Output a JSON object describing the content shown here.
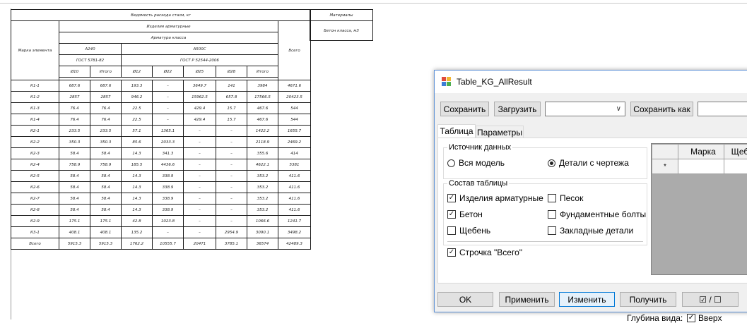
{
  "cad": {
    "header": {
      "title": "Ведомость расхода стали, кг",
      "materials": "Материалы",
      "products": "Изделия арматурные",
      "armature_class": "Арматура класса",
      "concrete": "Бетон класса, м3",
      "element_mark": "Марка элемента",
      "class_a240": "A240",
      "class_a500": "A500C",
      "gost_a240": "ГОСТ 5781-82",
      "gost_a500": "ГОСТ Р 52544-2006",
      "total": "Всего",
      "cols": [
        "Ø10",
        "Итого",
        "Ø12",
        "Ø22",
        "Ø25",
        "Ø28",
        "Итого"
      ]
    },
    "rows": [
      [
        "К1-1",
        "687.6",
        "687.6",
        "193.3",
        "–",
        "3649.7",
        "141",
        "3984",
        "4671.6"
      ],
      [
        "К1-2",
        "2857",
        "2857",
        "946.2",
        "–",
        "15962.5",
        "657.8",
        "17566.5",
        "20423.5"
      ],
      [
        "К1-3",
        "76.4",
        "76.4",
        "22.5",
        "–",
        "429.4",
        "15.7",
        "467.6",
        "544"
      ],
      [
        "К1-4",
        "76.4",
        "76.4",
        "22.5",
        "–",
        "429.4",
        "15.7",
        "467.6",
        "544"
      ],
      [
        "К2-1",
        "233.5",
        "233.5",
        "57.1",
        "1365.1",
        "–",
        "–",
        "1422.2",
        "1655.7"
      ],
      [
        "К2-2",
        "350.3",
        "350.3",
        "85.6",
        "2033.3",
        "–",
        "–",
        "2118.9",
        "2469.2"
      ],
      [
        "К2-3",
        "58.4",
        "58.4",
        "14.3",
        "341.3",
        "–",
        "–",
        "355.6",
        "414"
      ],
      [
        "К2-4",
        "758.9",
        "758.9",
        "185.5",
        "4436.6",
        "–",
        "–",
        "4622.1",
        "5381"
      ],
      [
        "К2-5",
        "58.4",
        "58.4",
        "14.3",
        "338.9",
        "–",
        "–",
        "353.2",
        "411.6"
      ],
      [
        "К2-6",
        "58.4",
        "58.4",
        "14.3",
        "338.9",
        "–",
        "–",
        "353.2",
        "411.6"
      ],
      [
        "К2-7",
        "58.4",
        "58.4",
        "14.3",
        "338.9",
        "–",
        "–",
        "353.2",
        "411.6"
      ],
      [
        "К2-8",
        "58.4",
        "58.4",
        "14.3",
        "338.9",
        "–",
        "–",
        "353.2",
        "411.6"
      ],
      [
        "К2-9",
        "175.1",
        "175.1",
        "42.8",
        "1023.8",
        "–",
        "–",
        "1066.6",
        "1241.7"
      ],
      [
        "К3-1",
        "408.1",
        "408.1",
        "135.2",
        "–",
        "–",
        "2954.9",
        "3090.1",
        "3498.2"
      ],
      [
        "Всего",
        "5915.3",
        "5915.3",
        "1762.2",
        "10555.7",
        "20471",
        "3785.1",
        "36574",
        "42489.3"
      ]
    ]
  },
  "dialog": {
    "title": "Table_KG_AllResult",
    "toolbar": {
      "save": "Сохранить",
      "load": "Загрузить",
      "preset_value": "",
      "save_as": "Сохранить как",
      "name_value": ""
    },
    "tabs": [
      "Таблица",
      "Параметры"
    ],
    "source": {
      "title": "Источник данных",
      "options": [
        {
          "label": "Вся модель",
          "selected": false
        },
        {
          "label": "Детали с чертежа",
          "selected": true
        }
      ]
    },
    "composition": {
      "title": "Состав таблицы",
      "items": [
        {
          "label": "Изделия арматурные",
          "checked": true
        },
        {
          "label": "Песок",
          "checked": false
        },
        {
          "label": "Бетон",
          "checked": true
        },
        {
          "label": "Фундаментные болты",
          "checked": false
        },
        {
          "label": "Щебень",
          "checked": false
        },
        {
          "label": "Закладные детали",
          "checked": false
        }
      ],
      "total_row": {
        "label": "Строчка \"Всего\"",
        "checked": true
      }
    },
    "grid": {
      "columns": [
        "Марка",
        "Щеб"
      ],
      "new_row_marker": "*"
    },
    "buttons": {
      "ok": "OK",
      "apply": "Применить",
      "change": "Изменить",
      "get": "Получить",
      "toggle": "☑ / ☐"
    }
  },
  "background": {
    "depth_label": "Глубина вида:",
    "top_label": "Вверх",
    "top_checked": true
  }
}
